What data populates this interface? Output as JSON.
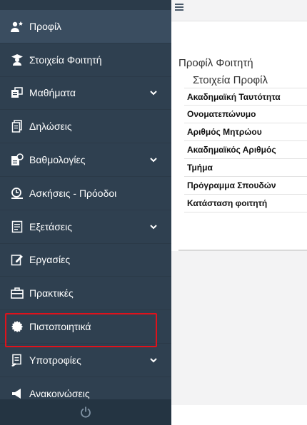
{
  "sidebar": {
    "items": [
      {
        "label": "Προφίλ",
        "icon": "user-star-icon",
        "active": true,
        "expandable": false
      },
      {
        "label": "Στοιχεία Φοιτητή",
        "icon": "graduate-icon",
        "active": false,
        "expandable": false
      },
      {
        "label": "Μαθήματα",
        "icon": "courses-icon",
        "active": false,
        "expandable": true
      },
      {
        "label": "Δηλώσεις",
        "icon": "documents-icon",
        "active": false,
        "expandable": false
      },
      {
        "label": "Βαθμολογίες",
        "icon": "grades-icon",
        "active": false,
        "expandable": true
      },
      {
        "label": "Ασκήσεις - Πρόοδοι",
        "icon": "exercises-icon",
        "active": false,
        "expandable": false
      },
      {
        "label": "Εξετάσεις",
        "icon": "exams-icon",
        "active": false,
        "expandable": true
      },
      {
        "label": "Εργασίες",
        "icon": "edit-icon",
        "active": false,
        "expandable": false
      },
      {
        "label": "Πρακτικές",
        "icon": "briefcase-icon",
        "active": false,
        "expandable": false
      },
      {
        "label": "Πιστοποιητικά",
        "icon": "certificate-icon",
        "active": false,
        "expandable": false,
        "highlighted": true
      },
      {
        "label": "Υποτροφίες",
        "icon": "scholarship-icon",
        "active": false,
        "expandable": true
      },
      {
        "label": "Ανακοινώσεις",
        "icon": "announcements-icon",
        "active": false,
        "expandable": false
      }
    ],
    "bottom_icon": "power-icon",
    "highlight_color": "#e0121b"
  },
  "topbar": {
    "menu_icon": "hamburger-icon"
  },
  "main": {
    "page_title": "Προφίλ Φοιτητή",
    "section_title": "Στοιχεία Προφίλ",
    "fields": [
      "Ακαδημαϊκή Ταυτότητα",
      "Ονοματεπώνυμο",
      "Αριθμός Μητρώου",
      "Ακαδημαϊκός Αριθμός",
      "Τμήμα",
      "Πρόγραμμα Σπουδών",
      "Κατάσταση φοιτητή"
    ]
  },
  "colors": {
    "sidebar_bg": "#2f4050",
    "active_bg": "#3a4d60",
    "text": "#ffffff"
  }
}
